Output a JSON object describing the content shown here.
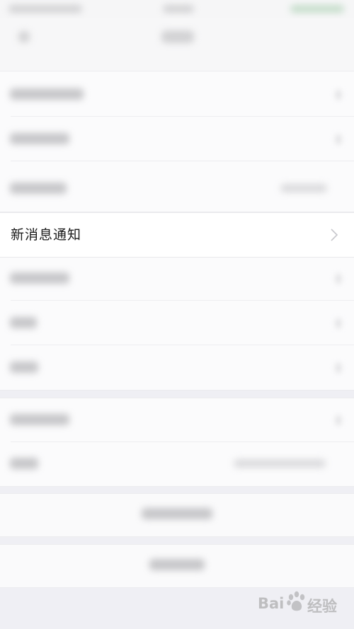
{
  "settings_list": {
    "notification_row": {
      "label": "新消息通知"
    }
  },
  "icons": {
    "chevron": "chevron-right-icon"
  },
  "watermark": {
    "brand_prefix": "Bai",
    "brand_suffix": "经验"
  },
  "colors": {
    "background": "#efeff4",
    "row_background": "#ffffff",
    "label": "#1a1a1a",
    "chevron": "#c7c7cc"
  }
}
